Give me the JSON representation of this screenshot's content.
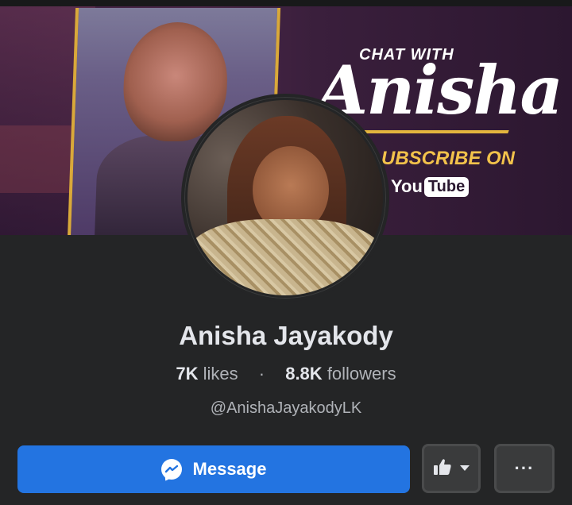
{
  "cover": {
    "chat_with": "CHAT WITH",
    "big_name": "Anisha",
    "subscribe": "UBSCRIBE ON",
    "youtube_you": "You",
    "youtube_tube": "Tube"
  },
  "profile": {
    "name": "Anisha Jayakody",
    "likes_count": "7K",
    "likes_label": "likes",
    "separator": "·",
    "followers_count": "8.8K",
    "followers_label": "followers",
    "handle": "@AnishaJayakodyLK"
  },
  "actions": {
    "message_label": "Message",
    "more_label": "···"
  },
  "colors": {
    "background": "#242526",
    "primary_button": "#2374e1",
    "secondary_button": "#3a3b3c",
    "text_primary": "#e4e6eb",
    "text_secondary": "#b0b3b8"
  },
  "icons": {
    "message_icon": "messenger-icon",
    "like_icon": "thumbs-up-icon",
    "dropdown_icon": "caret-down-icon",
    "more_icon": "ellipsis-icon"
  }
}
